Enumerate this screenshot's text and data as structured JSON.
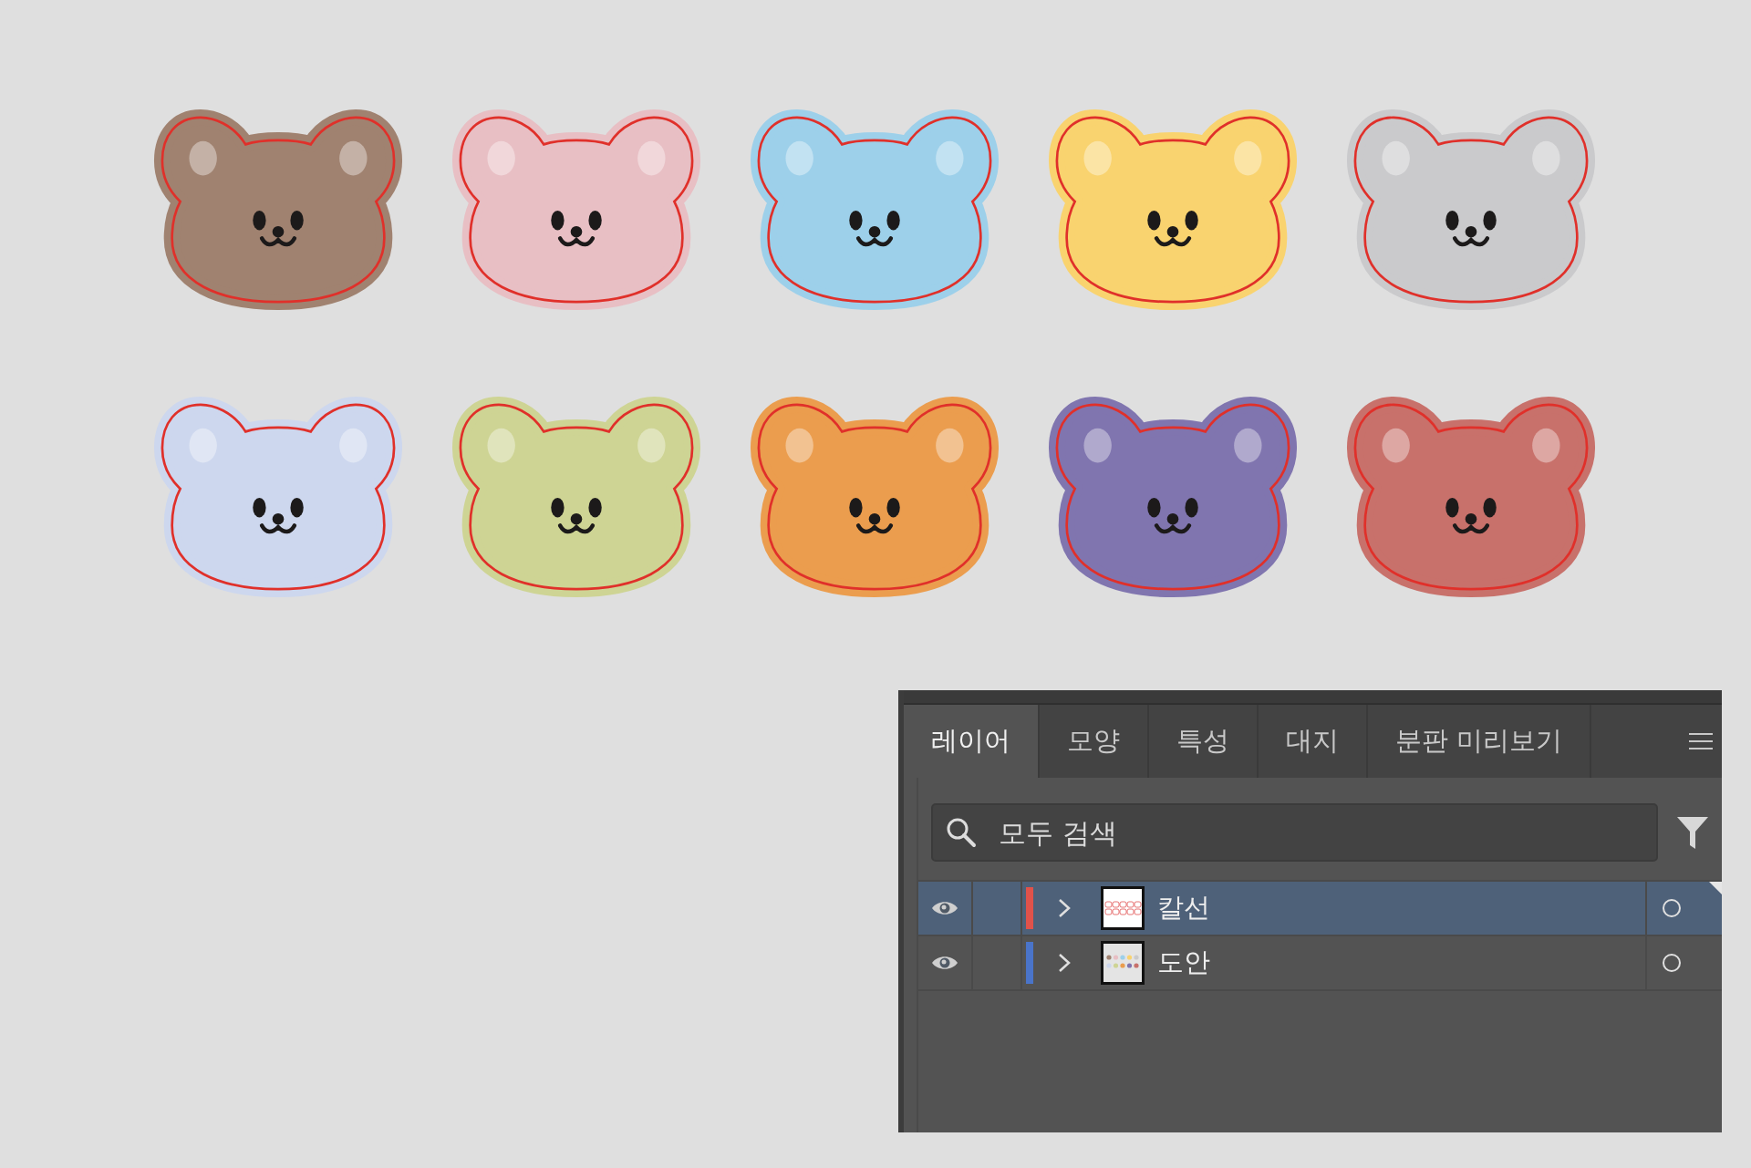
{
  "canvas": {
    "bears": [
      {
        "color": "#a08270"
      },
      {
        "color": "#e8bfc4"
      },
      {
        "color": "#9dd0ea"
      },
      {
        "color": "#f9d36f"
      },
      {
        "color": "#cacacc"
      },
      {
        "color": "#cdd7ee"
      },
      {
        "color": "#ced494"
      },
      {
        "color": "#eb9d4e"
      },
      {
        "color": "#8075af"
      },
      {
        "color": "#c8716b"
      }
    ]
  },
  "layers_panel": {
    "tabs": [
      {
        "label": "레이어",
        "selected": true
      },
      {
        "label": "모양",
        "selected": false
      },
      {
        "label": "특성",
        "selected": false
      },
      {
        "label": "대지",
        "selected": false
      },
      {
        "label": "분판 미리보기",
        "selected": false
      }
    ],
    "search": {
      "placeholder": "모두 검색"
    },
    "layers": [
      {
        "name": "칼선",
        "kind": "cutlines",
        "selected": true,
        "visible": true,
        "expanded": false,
        "color": "#e0524a"
      },
      {
        "name": "도안",
        "kind": "artwork",
        "selected": false,
        "visible": true,
        "expanded": false,
        "color": "#4a74c9"
      }
    ]
  }
}
